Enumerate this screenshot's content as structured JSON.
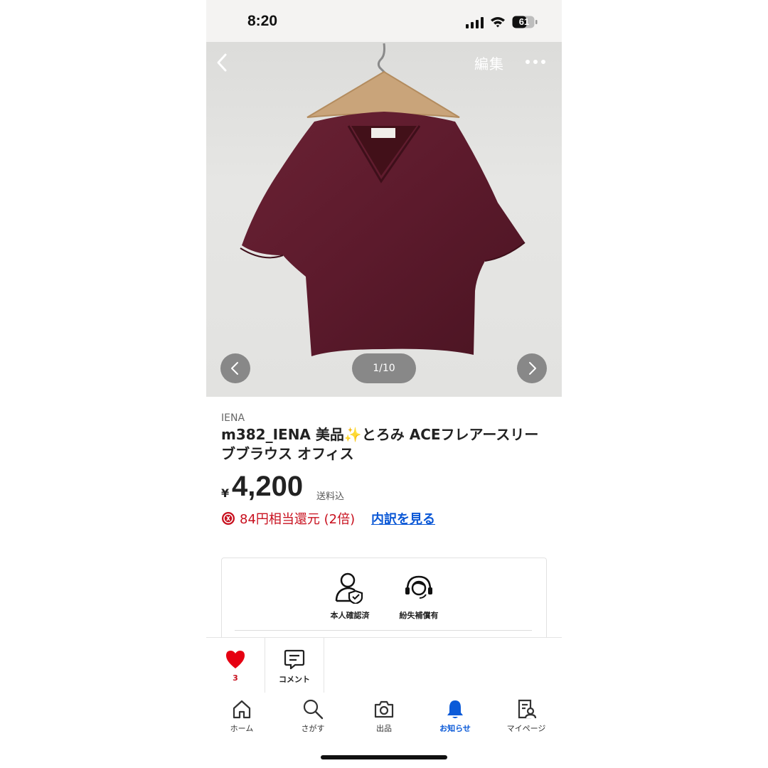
{
  "status_bar": {
    "time": "8:20",
    "battery": "61"
  },
  "photo": {
    "edit_label": "編集",
    "counter": "1/10",
    "icons": [
      "back-chevron-icon",
      "more-dots-icon",
      "chevron-left-icon",
      "chevron-right-icon"
    ],
    "garment_color": "#5b1a2c"
  },
  "item": {
    "brand": "IENA",
    "title": "m382_IENA 美品✨とろみ ACEフレアースリーブブラウス オフィス",
    "currency": "¥",
    "price": "4,200",
    "shipping": "送料込",
    "points_text": "84円相当還元 (2倍)",
    "points_link": "内訳を見る"
  },
  "features": [
    {
      "label": "本人確認済",
      "icon": "identity-verified-icon"
    },
    {
      "label": "紛失補償有",
      "icon": "loss-compensation-icon"
    }
  ],
  "actions": {
    "like_count": "3",
    "comment_label": "コメント"
  },
  "tabs": [
    {
      "label": "ホーム",
      "icon": "home-icon"
    },
    {
      "label": "さがす",
      "icon": "search-icon"
    },
    {
      "label": "出品",
      "icon": "camera-icon"
    },
    {
      "label": "お知らせ",
      "icon": "bell-icon",
      "active": true
    },
    {
      "label": "マイページ",
      "icon": "mypage-icon"
    }
  ],
  "colors": {
    "accent_red": "#c8101e",
    "link_blue": "#0b58d6",
    "active_tab": "#0b5ad8"
  }
}
